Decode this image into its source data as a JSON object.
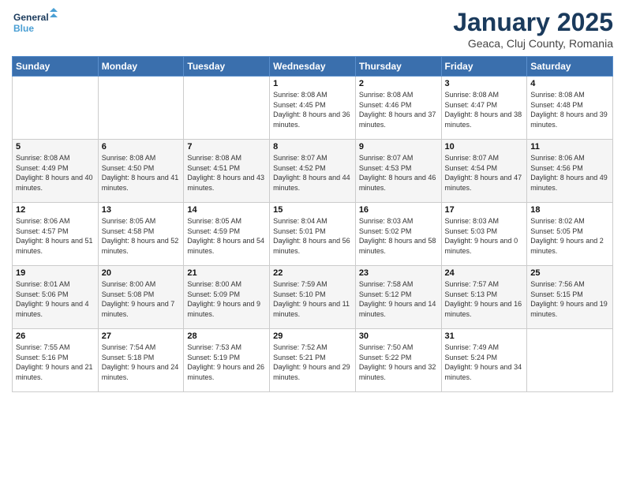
{
  "header": {
    "logo_line1": "General",
    "logo_line2": "Blue",
    "month": "January 2025",
    "location": "Geaca, Cluj County, Romania"
  },
  "days_of_week": [
    "Sunday",
    "Monday",
    "Tuesday",
    "Wednesday",
    "Thursday",
    "Friday",
    "Saturday"
  ],
  "weeks": [
    [
      {
        "num": "",
        "info": ""
      },
      {
        "num": "",
        "info": ""
      },
      {
        "num": "",
        "info": ""
      },
      {
        "num": "1",
        "info": "Sunrise: 8:08 AM\nSunset: 4:45 PM\nDaylight: 8 hours and 36 minutes."
      },
      {
        "num": "2",
        "info": "Sunrise: 8:08 AM\nSunset: 4:46 PM\nDaylight: 8 hours and 37 minutes."
      },
      {
        "num": "3",
        "info": "Sunrise: 8:08 AM\nSunset: 4:47 PM\nDaylight: 8 hours and 38 minutes."
      },
      {
        "num": "4",
        "info": "Sunrise: 8:08 AM\nSunset: 4:48 PM\nDaylight: 8 hours and 39 minutes."
      }
    ],
    [
      {
        "num": "5",
        "info": "Sunrise: 8:08 AM\nSunset: 4:49 PM\nDaylight: 8 hours and 40 minutes."
      },
      {
        "num": "6",
        "info": "Sunrise: 8:08 AM\nSunset: 4:50 PM\nDaylight: 8 hours and 41 minutes."
      },
      {
        "num": "7",
        "info": "Sunrise: 8:08 AM\nSunset: 4:51 PM\nDaylight: 8 hours and 43 minutes."
      },
      {
        "num": "8",
        "info": "Sunrise: 8:07 AM\nSunset: 4:52 PM\nDaylight: 8 hours and 44 minutes."
      },
      {
        "num": "9",
        "info": "Sunrise: 8:07 AM\nSunset: 4:53 PM\nDaylight: 8 hours and 46 minutes."
      },
      {
        "num": "10",
        "info": "Sunrise: 8:07 AM\nSunset: 4:54 PM\nDaylight: 8 hours and 47 minutes."
      },
      {
        "num": "11",
        "info": "Sunrise: 8:06 AM\nSunset: 4:56 PM\nDaylight: 8 hours and 49 minutes."
      }
    ],
    [
      {
        "num": "12",
        "info": "Sunrise: 8:06 AM\nSunset: 4:57 PM\nDaylight: 8 hours and 51 minutes."
      },
      {
        "num": "13",
        "info": "Sunrise: 8:05 AM\nSunset: 4:58 PM\nDaylight: 8 hours and 52 minutes."
      },
      {
        "num": "14",
        "info": "Sunrise: 8:05 AM\nSunset: 4:59 PM\nDaylight: 8 hours and 54 minutes."
      },
      {
        "num": "15",
        "info": "Sunrise: 8:04 AM\nSunset: 5:01 PM\nDaylight: 8 hours and 56 minutes."
      },
      {
        "num": "16",
        "info": "Sunrise: 8:03 AM\nSunset: 5:02 PM\nDaylight: 8 hours and 58 minutes."
      },
      {
        "num": "17",
        "info": "Sunrise: 8:03 AM\nSunset: 5:03 PM\nDaylight: 9 hours and 0 minutes."
      },
      {
        "num": "18",
        "info": "Sunrise: 8:02 AM\nSunset: 5:05 PM\nDaylight: 9 hours and 2 minutes."
      }
    ],
    [
      {
        "num": "19",
        "info": "Sunrise: 8:01 AM\nSunset: 5:06 PM\nDaylight: 9 hours and 4 minutes."
      },
      {
        "num": "20",
        "info": "Sunrise: 8:00 AM\nSunset: 5:08 PM\nDaylight: 9 hours and 7 minutes."
      },
      {
        "num": "21",
        "info": "Sunrise: 8:00 AM\nSunset: 5:09 PM\nDaylight: 9 hours and 9 minutes."
      },
      {
        "num": "22",
        "info": "Sunrise: 7:59 AM\nSunset: 5:10 PM\nDaylight: 9 hours and 11 minutes."
      },
      {
        "num": "23",
        "info": "Sunrise: 7:58 AM\nSunset: 5:12 PM\nDaylight: 9 hours and 14 minutes."
      },
      {
        "num": "24",
        "info": "Sunrise: 7:57 AM\nSunset: 5:13 PM\nDaylight: 9 hours and 16 minutes."
      },
      {
        "num": "25",
        "info": "Sunrise: 7:56 AM\nSunset: 5:15 PM\nDaylight: 9 hours and 19 minutes."
      }
    ],
    [
      {
        "num": "26",
        "info": "Sunrise: 7:55 AM\nSunset: 5:16 PM\nDaylight: 9 hours and 21 minutes."
      },
      {
        "num": "27",
        "info": "Sunrise: 7:54 AM\nSunset: 5:18 PM\nDaylight: 9 hours and 24 minutes."
      },
      {
        "num": "28",
        "info": "Sunrise: 7:53 AM\nSunset: 5:19 PM\nDaylight: 9 hours and 26 minutes."
      },
      {
        "num": "29",
        "info": "Sunrise: 7:52 AM\nSunset: 5:21 PM\nDaylight: 9 hours and 29 minutes."
      },
      {
        "num": "30",
        "info": "Sunrise: 7:50 AM\nSunset: 5:22 PM\nDaylight: 9 hours and 32 minutes."
      },
      {
        "num": "31",
        "info": "Sunrise: 7:49 AM\nSunset: 5:24 PM\nDaylight: 9 hours and 34 minutes."
      },
      {
        "num": "",
        "info": ""
      }
    ]
  ]
}
